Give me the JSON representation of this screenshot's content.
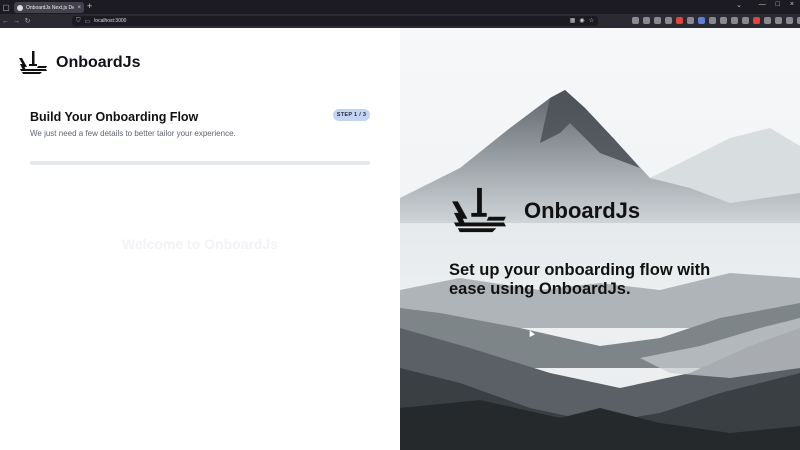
{
  "browser": {
    "tab_title": "OnboardJs Next.js Demo",
    "url": "localhost:3000",
    "tab_close": "×",
    "new_tab": "+",
    "window_controls": [
      "—",
      "□",
      "×"
    ]
  },
  "brand": {
    "name": "OnboardJs"
  },
  "onboarding": {
    "title": "Build Your Onboarding Flow",
    "subtitle": "We just need a few details to better tailor your experience.",
    "step_badge": "STEP 1 / 3",
    "progress_fraction": 0.0,
    "welcome_text": "Welcome to OnboardJs"
  },
  "hero": {
    "brand_name": "OnboardJs",
    "tagline": "Set up your onboarding flow with ease using OnboardJs."
  },
  "colors": {
    "badge_bg": "#c3d4f2",
    "progress_track": "#e4e8ee",
    "text_dark": "#111111"
  }
}
